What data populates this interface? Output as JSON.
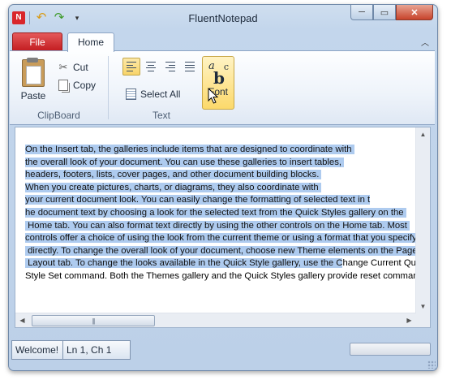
{
  "window": {
    "title": "FluentNotepad"
  },
  "quick_access": {
    "app_icon": "N",
    "undo_icon": "↶",
    "redo_icon": "↷",
    "customize_icon": "▾"
  },
  "window_buttons": {
    "minimize": "─",
    "maximize": "▭",
    "close": "✕"
  },
  "ribbon": {
    "tabs": {
      "file": "File",
      "home": "Home"
    },
    "minimize_icon": "︿",
    "clipboard": {
      "label": "ClipBoard",
      "paste": "Paste",
      "cut": "Cut",
      "copy": "Copy"
    },
    "text": {
      "label": "Text",
      "select_all": "Select All",
      "font": "Font",
      "selected_alignment": "left"
    }
  },
  "document": {
    "lines": [
      {
        "sel": "On the Insert tab, the galleries include items that are designed to coordinate with ",
        "rest": ""
      },
      {
        "sel": "the overall look of your document. You can use these galleries to insert tables, ",
        "rest": ""
      },
      {
        "sel": "headers, footers, lists, cover pages, and other document building blocks. ",
        "rest": ""
      },
      {
        "sel": "When you create pictures, charts, or diagrams, they also coordinate with ",
        "rest": ""
      },
      {
        "sel": "your current document look. You can easily change the formatting of selected text in t",
        "rest": ""
      },
      {
        "sel": "he document text by choosing a look for the selected text from the Quick Styles gallery on the ",
        "rest": ""
      },
      {
        "sel": " Home tab. You can also format text directly by using the other controls on the Home tab. Most ",
        "rest": ""
      },
      {
        "sel": "controls offer a choice of using the look from the current theme or using a format that you specify ",
        "rest": ""
      },
      {
        "sel": " directly. To change the overall look of your document, choose new Theme elements on the Page ",
        "rest": ""
      },
      {
        "sel": " Layout tab. To change the looks available in the Quick Style gallery, use the C",
        "rest": "hange Current Quick"
      },
      {
        "sel": "",
        "rest": "Style Set command. Both the Themes gallery and the Quick Styles gallery provide reset commands s"
      }
    ]
  },
  "scrollbar": {
    "up": "▲",
    "down": "▼",
    "left": "◀",
    "right": "▶",
    "thumb_grip": "|||"
  },
  "status": {
    "message": "Welcome!",
    "position": "Ln 1, Ch 1"
  },
  "colors": {
    "selection": "#aecbef",
    "file_tab": "#c21b1f",
    "highlight": "#fcd96b"
  }
}
